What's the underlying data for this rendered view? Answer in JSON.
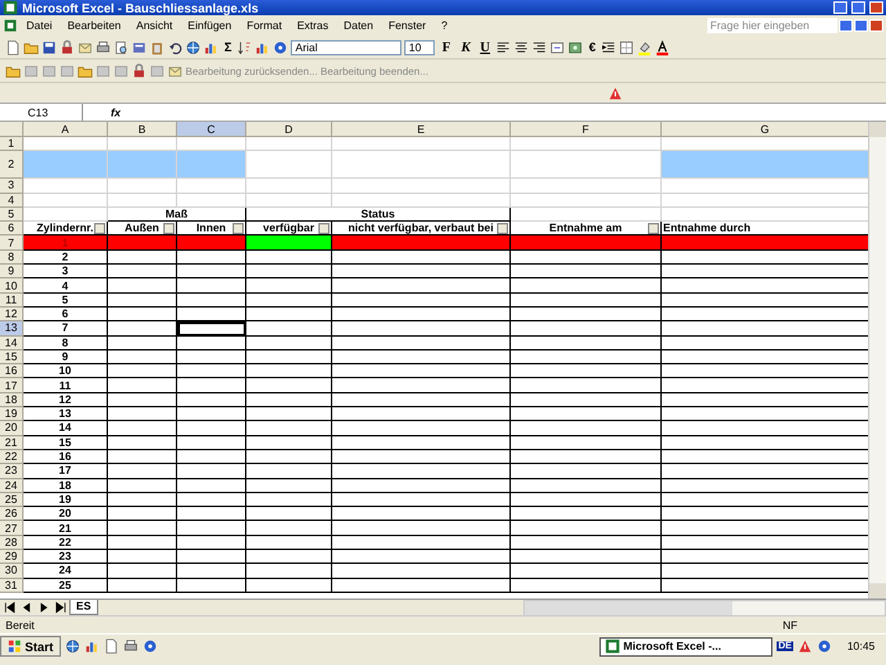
{
  "window": {
    "title": "Microsoft Excel - Bauschliessanlage.xls"
  },
  "menu": [
    {
      "label": "Datei"
    },
    {
      "label": "Bearbeiten"
    },
    {
      "label": "Ansicht"
    },
    {
      "label": "Einfügen"
    },
    {
      "label": "Format"
    },
    {
      "label": "Extras"
    },
    {
      "label": "Daten"
    },
    {
      "label": "Fenster"
    },
    {
      "label": "?"
    }
  ],
  "help_box": {
    "placeholder": "Frage hier eingeben"
  },
  "toolbar": {
    "sum": "Σ",
    "font": "Arial",
    "size": "10",
    "bold": "F",
    "italic": "K",
    "underline": "U",
    "euro": "€"
  },
  "review_toolbar": {
    "send_back": "Bearbeitung zurücksenden...",
    "end": "Bearbeitung beenden..."
  },
  "formula_bar": {
    "name_box": "C13",
    "fx": "fx"
  },
  "columns": [
    {
      "label": "A",
      "selected": false
    },
    {
      "label": "B",
      "selected": false
    },
    {
      "label": "C",
      "selected": true
    },
    {
      "label": "D",
      "selected": false
    },
    {
      "label": "E",
      "selected": false
    },
    {
      "label": "F",
      "selected": false
    },
    {
      "label": "G",
      "selected": false
    }
  ],
  "rows": [
    {
      "label": "1",
      "selected": false,
      "kind": "blank"
    },
    {
      "label": "2",
      "selected": false,
      "kind": "banner",
      "cells": [
        {
          "color": "#99ccff"
        },
        {
          "color": "#99ccff"
        },
        {
          "color": "#99ccff"
        },
        {
          "color": "#ffffff"
        },
        {
          "color": "#ffffff"
        },
        {
          "color": "#ffffff"
        },
        {
          "color": "#99ccff"
        }
      ]
    },
    {
      "label": "3",
      "selected": false,
      "kind": "blank"
    },
    {
      "label": "4",
      "selected": false,
      "kind": "blank"
    },
    {
      "label": "5",
      "selected": false,
      "kind": "group",
      "cells": [
        {
          "kind": "empty"
        },
        {
          "kind": "merged",
          "text": "Maß"
        },
        {
          "kind": "merged",
          "text": "Status"
        },
        {
          "kind": "empty"
        },
        {
          "kind": "empty"
        }
      ]
    },
    {
      "label": "6",
      "selected": false,
      "kind": "header",
      "cells": [
        {
          "kind": "filter",
          "text": "Zylindernr."
        },
        {
          "kind": "filter",
          "text": "Außen"
        },
        {
          "kind": "filter",
          "text": "Innen"
        },
        {
          "kind": "filter",
          "text": "verfügbar"
        },
        {
          "kind": "filter",
          "text": "nicht verfügbar, verbaut bei"
        },
        {
          "kind": "filter",
          "text": "Entnahme am"
        },
        {
          "kind": "text",
          "text": "Entnahme durch"
        }
      ]
    },
    {
      "label": "7",
      "selected": false,
      "kind": "data",
      "number": "1",
      "cells": [
        {
          "color": "#ff0000"
        },
        {
          "color": "#ff0000"
        },
        {
          "color": "#ff0000"
        },
        {
          "color": "#00ff00"
        },
        {
          "color": "#ff0000"
        },
        {
          "color": "#ff0000"
        },
        {
          "color": "#ff0000"
        }
      ]
    },
    {
      "label": "8",
      "selected": false,
      "kind": "data",
      "number": "2"
    },
    {
      "label": "9",
      "selected": false,
      "kind": "data",
      "number": "3"
    },
    {
      "label": "10",
      "selected": false,
      "kind": "data",
      "number": "4"
    },
    {
      "label": "11",
      "selected": false,
      "kind": "data",
      "number": "5"
    },
    {
      "label": "12",
      "selected": false,
      "kind": "data",
      "number": "6"
    },
    {
      "label": "13",
      "selected": true,
      "kind": "data",
      "number": "7"
    },
    {
      "label": "14",
      "selected": false,
      "kind": "data",
      "number": "8"
    },
    {
      "label": "15",
      "selected": false,
      "kind": "data",
      "number": "9"
    },
    {
      "label": "16",
      "selected": false,
      "kind": "data",
      "number": "10"
    },
    {
      "label": "17",
      "selected": false,
      "kind": "data",
      "number": "11"
    },
    {
      "label": "18",
      "selected": false,
      "kind": "data",
      "number": "12"
    },
    {
      "label": "19",
      "selected": false,
      "kind": "data",
      "number": "13"
    },
    {
      "label": "20",
      "selected": false,
      "kind": "data",
      "number": "14"
    },
    {
      "label": "21",
      "selected": false,
      "kind": "data",
      "number": "15"
    },
    {
      "label": "22",
      "selected": false,
      "kind": "data",
      "number": "16"
    },
    {
      "label": "23",
      "selected": false,
      "kind": "data",
      "number": "17"
    },
    {
      "label": "24",
      "selected": false,
      "kind": "data",
      "number": "18"
    },
    {
      "label": "25",
      "selected": false,
      "kind": "data",
      "number": "19"
    },
    {
      "label": "26",
      "selected": false,
      "kind": "data",
      "number": "20"
    },
    {
      "label": "27",
      "selected": false,
      "kind": "data",
      "number": "21"
    },
    {
      "label": "28",
      "selected": false,
      "kind": "data",
      "number": "22"
    },
    {
      "label": "29",
      "selected": false,
      "kind": "data",
      "number": "23"
    },
    {
      "label": "30",
      "selected": false,
      "kind": "data",
      "number": "24"
    },
    {
      "label": "31",
      "selected": false,
      "kind": "data",
      "number": "25"
    }
  ],
  "sheet_tabs": [
    {
      "label": "ES",
      "selected": true
    }
  ],
  "status_bar": {
    "status": "Bereit",
    "mode": "NF"
  },
  "taskbar": {
    "start": "Start",
    "task": "Microsoft Excel -...",
    "language": "DE",
    "clock": "10:45"
  }
}
